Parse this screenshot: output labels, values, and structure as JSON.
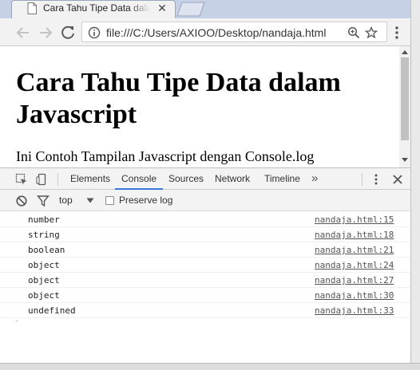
{
  "browser": {
    "tab": {
      "title": "Cara Tahu Tipe Data dalam Javascript",
      "close_glyph": "✕"
    },
    "address": {
      "url": "file:///C:/Users/AXIOO/Desktop/nandaja.html"
    },
    "icons": [
      "back-arrow-icon",
      "forward-arrow-icon",
      "reload-icon",
      "info-icon",
      "zoom-icon",
      "star-icon",
      "menu-dots-icon"
    ]
  },
  "page": {
    "heading": "Cara Tahu Tipe Data dalam Javascript",
    "text": "Ini Contoh Tampilan Javascript dengan Console.log"
  },
  "devtools": {
    "tabs": [
      "Elements",
      "Console",
      "Sources",
      "Network",
      "Timeline"
    ],
    "active_tab": "Console",
    "more_glyph": "»",
    "accent_color": "#3879d9",
    "toolbar": {
      "context": "top",
      "preserve_log_label": "Preserve log",
      "preserve_log_checked": false
    },
    "console_rows": [
      {
        "message": "number",
        "source": "nandaja.html:15"
      },
      {
        "message": "string",
        "source": "nandaja.html:18"
      },
      {
        "message": "boolean",
        "source": "nandaja.html:21"
      },
      {
        "message": "object",
        "source": "nandaja.html:24"
      },
      {
        "message": "object",
        "source": "nandaja.html:27"
      },
      {
        "message": "object",
        "source": "nandaja.html:30"
      },
      {
        "message": "undefined",
        "source": "nandaja.html:33"
      }
    ]
  }
}
